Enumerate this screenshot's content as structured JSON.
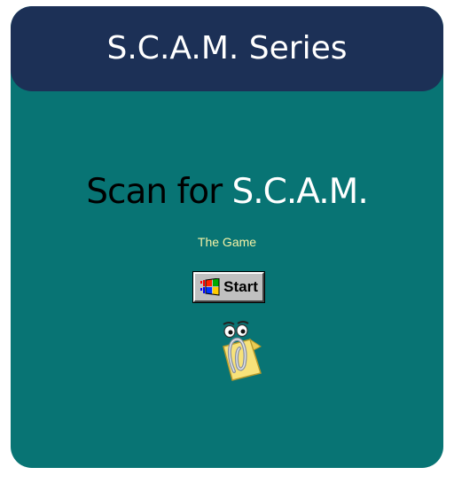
{
  "header": {
    "title": "S.C.A.M. Series"
  },
  "game": {
    "title_part1": "Scan for ",
    "title_part2": "S.C.A.M.",
    "subtitle": "The Game"
  },
  "start_button": {
    "label": "Start",
    "icon": "windows-logo-icon"
  },
  "mascot": {
    "icon": "paperclip-assistant-icon"
  },
  "colors": {
    "page": "#ffffff",
    "card": "#087474",
    "header": "#1c3056",
    "subtitle": "#f4f2a6",
    "button": "#c0c0c0"
  }
}
